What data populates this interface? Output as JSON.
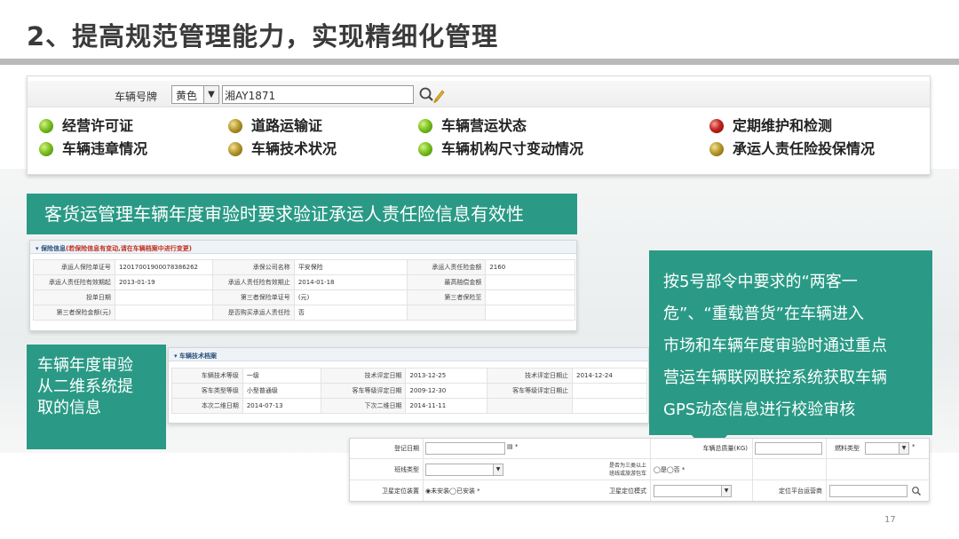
{
  "title": "2、提高规范管理能力，实现精细化管理",
  "search": {
    "label": "车辆号牌",
    "color_select": "黄色",
    "plate_value": "湘AY1871"
  },
  "status_items": [
    {
      "label": "经营许可证",
      "status": "green"
    },
    {
      "label": "道路运输证",
      "status": "gold"
    },
    {
      "label": "车辆营运状态",
      "status": "green"
    },
    {
      "label": "定期维护和检测",
      "status": "red"
    },
    {
      "label": "车辆违章情况",
      "status": "green"
    },
    {
      "label": "车辆技术状况",
      "status": "gold"
    },
    {
      "label": "车辆机构尺寸变动情况",
      "status": "green"
    },
    {
      "label": "承运人责任险投保情况",
      "status": "gold"
    }
  ],
  "callouts": {
    "insurance": "客货运管理车辆年度审验时要求验证承运人责任险信息有效性",
    "annual_review": [
      "车辆年度审验",
      "从二维系统提",
      "取的信息"
    ],
    "gps": [
      "按5号部令中要求的“两客一",
      "危”、“重载普货”在车辆进入",
      "市场和车辆年度审验时通过重点",
      "营运车辆联网联控系统获取车辆",
      "GPS动态信息进行校验审核"
    ]
  },
  "insurance_panel": {
    "header_title": "保险信息",
    "header_note": "(若保险信息有变动,请在车辆档案中进行变更)",
    "rows": [
      [
        "承运人保险单证号",
        "1201700190007838626​2",
        "承保公司名称",
        "平安保险",
        "承运人责任险金额",
        "2160"
      ],
      [
        "承运人责任险有效期起",
        "2013-01-19",
        "承运人责任险有效期止",
        "2014-01-18",
        "最高赔偿金额",
        ""
      ],
      [
        "投单日期",
        "",
        "第三者保险单证号",
        "(元)",
        "第三者保险至",
        ""
      ],
      [
        "第三者保险金额(元)",
        "",
        "是否购买承运人责任险",
        "否",
        "",
        ""
      ]
    ]
  },
  "tech_panel": {
    "header_title": "车辆技术档案",
    "rows": [
      [
        "车辆技术等级",
        "一级",
        "技术评定日期",
        "2013-12-25",
        "技术评定日期止",
        "2014-12-24"
      ],
      [
        "客车类型等级",
        "小型普通级",
        "客车等级评定日期",
        "2009-12-30",
        "客车等级评定日期止",
        ""
      ],
      [
        "本次二维日期",
        "2014-07-13",
        "下次二维日期",
        "2014-11-11",
        "",
        ""
      ]
    ]
  },
  "form_panel": {
    "reg_date_label": "登记日期",
    "weight_label": "车辆总质量(KG)",
    "fuel_label": "燃料类型",
    "line_type_label": "班线类型",
    "three_class_label_1": "是否为三类以上",
    "three_class_label_2": "班线或旅游包车",
    "yes_no_text": "◯是◯否 *",
    "gps_device_label": "卫星定位装置",
    "gps_install_text": "◉未安装◯已安装 *",
    "gps_mode_label": "卫星定位模式",
    "gps_platform_label": "定位平台运营商"
  },
  "page_number": "17",
  "colors": {
    "callout_bg": "#2a9a86",
    "title_rule": "#b7b9bb",
    "status_green": "#7dc21f",
    "status_gold": "#b89a2c",
    "status_red": "#c4241c"
  }
}
